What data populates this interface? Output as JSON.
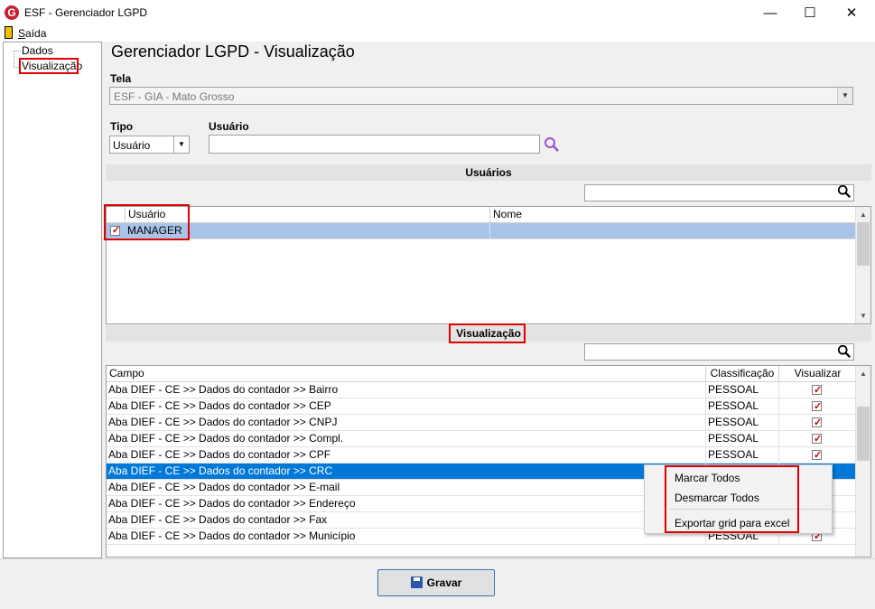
{
  "window": {
    "title": "ESF - Gerenciador LGPD",
    "logo_letter": "G",
    "minimize": "—",
    "maximize": "☐",
    "close": "✕"
  },
  "menu": {
    "exit_label": "Saída"
  },
  "tree": {
    "items": [
      {
        "label": "Dados"
      },
      {
        "label": "Visualização"
      }
    ]
  },
  "main": {
    "title": "Gerenciador LGPD - Visualização",
    "tela_label": "Tela",
    "tela_value": "ESF - GIA - Mato Grosso",
    "tipo_label": "Tipo",
    "tipo_value": "Usuário",
    "usuario_label": "Usuário",
    "usuario_value": ""
  },
  "users_section": {
    "header": "Usuários",
    "search_value": "",
    "columns": [
      "Usuário",
      "Nome"
    ],
    "rows": [
      {
        "checked": true,
        "usuario": "MANAGER",
        "nome": ""
      }
    ]
  },
  "vis_section": {
    "header": "Visualização",
    "search_value": "",
    "columns": [
      "Campo",
      "Classificação",
      "Visualizar"
    ],
    "rows": [
      {
        "campo": "Aba DIEF - CE >> Dados do contador >> Bairro",
        "classificacao": "PESSOAL",
        "visualizar": true
      },
      {
        "campo": "Aba DIEF - CE >> Dados do contador >> CEP",
        "classificacao": "PESSOAL",
        "visualizar": true
      },
      {
        "campo": "Aba DIEF - CE >> Dados do contador >> CNPJ",
        "classificacao": "PESSOAL",
        "visualizar": true
      },
      {
        "campo": "Aba DIEF - CE >> Dados do contador >> Compl.",
        "classificacao": "PESSOAL",
        "visualizar": true
      },
      {
        "campo": "Aba DIEF - CE >> Dados do contador >> CPF",
        "classificacao": "PESSOAL",
        "visualizar": true
      },
      {
        "campo": "Aba DIEF - CE >> Dados do contador >> CRC",
        "classificacao": "",
        "visualizar": false,
        "selected": true
      },
      {
        "campo": "Aba DIEF - CE >> Dados do contador >> E-mail",
        "classificacao": "",
        "visualizar": false
      },
      {
        "campo": "Aba DIEF - CE >> Dados do contador >> Endereço",
        "classificacao": "",
        "visualizar": false
      },
      {
        "campo": "Aba DIEF - CE >> Dados do contador >> Fax",
        "classificacao": "",
        "visualizar": false
      },
      {
        "campo": "Aba DIEF - CE >> Dados do contador >> Município",
        "classificacao": "PESSOAL",
        "visualizar": true
      }
    ]
  },
  "context_menu": {
    "items": [
      "Marcar Todos",
      "Desmarcar Todos",
      "Exportar grid para excel"
    ]
  },
  "footer": {
    "save_label": "Gravar"
  },
  "colors": {
    "selection": "#0078d7",
    "user_row": "#a9c4e8",
    "highlight_border": "#e00000",
    "check": "#d00000"
  }
}
